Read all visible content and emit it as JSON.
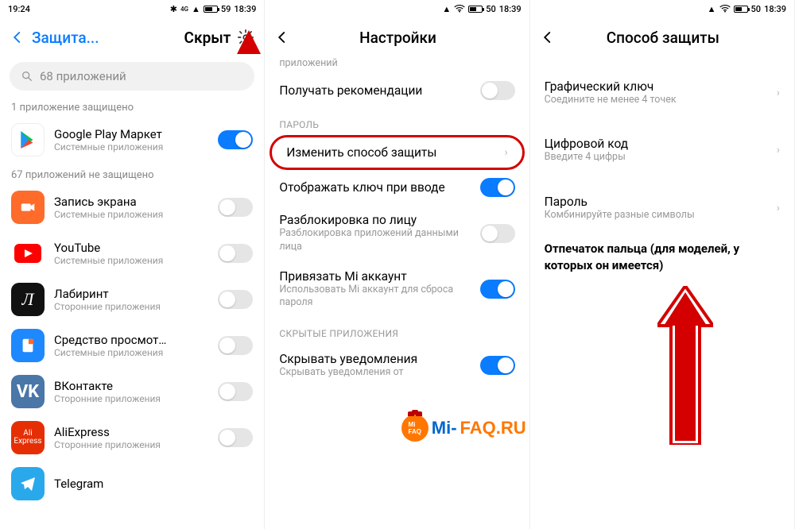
{
  "screen1": {
    "statusbar": {
      "time_left": "19:24",
      "battery": "59",
      "time_right": "18:39"
    },
    "title_left": "Защита...",
    "title_right": "Скрыт",
    "search_placeholder": "68 приложений",
    "section1_label": "1 приложение защищено",
    "section2_label": "67 приложений не защищено",
    "apps": [
      {
        "label": "Google Play Маркет",
        "sub": "Системные приложения",
        "on": true
      },
      {
        "label": "Запись экрана",
        "sub": "Системные приложения",
        "on": false
      },
      {
        "label": "YouTube",
        "sub": "Системные приложения",
        "on": false
      },
      {
        "label": "Лабиринт",
        "sub": "Сторонние приложения",
        "on": false
      },
      {
        "label": "Средство просмот…",
        "sub": "Системные приложения",
        "on": false
      },
      {
        "label": "ВКонтакте",
        "sub": "Сторонние приложения",
        "on": false
      },
      {
        "label": "AliExpress",
        "sub": "Сторонние приложения",
        "on": false
      },
      {
        "label": "Telegram",
        "sub": "",
        "on": false
      }
    ]
  },
  "screen2": {
    "statusbar": {
      "battery": "50",
      "time": "18:39"
    },
    "title": "Настройки",
    "cutoff": "приложений",
    "rows": {
      "recommend": "Получать рекомендации",
      "sectionPassword": "ПАРОЛЬ",
      "changeMethod": "Изменить способ защиты",
      "showKey": "Отображать ключ при вводе",
      "faceUnlock": "Разблокировка по лицу",
      "faceUnlockSub": "Разблокировка приложений данными лица",
      "miAccount": "Привязать Mi аккаунт",
      "miAccountSub": "Использовать Mi аккаунт для сброса пароля",
      "sectionHidden": "СКРЫТЫЕ ПРИЛОЖЕНИЯ",
      "hideNotif": "Скрывать уведомления",
      "hideNotifSub": "Скрывать уведомления от"
    }
  },
  "screen3": {
    "statusbar": {
      "battery": "50",
      "time": "18:39"
    },
    "title": "Способ защиты",
    "items": [
      {
        "label": "Графический ключ",
        "sub": "Соедините не менее 4 точек"
      },
      {
        "label": "Цифровой код",
        "sub": "Введите 4 цифры"
      },
      {
        "label": "Пароль",
        "sub": "Комбинируйте разные символы"
      }
    ],
    "note": "Отпечаток пальца (для моделей, у которых он имеется)",
    "watermark_blue": "Mi-",
    "watermark_orange": "FAQ.RU"
  }
}
